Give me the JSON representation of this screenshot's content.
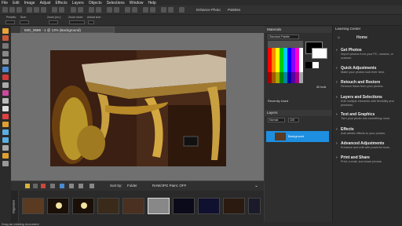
{
  "menu": [
    "File",
    "Edit",
    "Image",
    "Adjust",
    "Effects",
    "Layers",
    "Objects",
    "Selections",
    "Window",
    "Help"
  ],
  "toolbar": {
    "enhance_photo": "Enhance Photo",
    "palettes": "Palettes"
  },
  "options": {
    "labels": [
      "Presets:",
      "Size:",
      "Zoom (no.):",
      "Zoom more:",
      "Actual size:"
    ]
  },
  "document": {
    "tab": "IMG_9686 - 1 @ 13% (Background)"
  },
  "organizer": {
    "label": "Organizer",
    "sort_by": "Sort by:",
    "sort_value": "Folder",
    "filter": "RAW/JPG Pairs: OFF"
  },
  "materials": {
    "title": "Materials",
    "palette_select": "Standard Palette",
    "all_tools": "All tools",
    "recently_used": "Recently Used"
  },
  "layers": {
    "title": "Layers",
    "blend": "Normal",
    "opacity": "100",
    "layer_name": "Background"
  },
  "learning": {
    "title": "Learning Center",
    "home": "Home",
    "items": [
      {
        "title": "Get Photos",
        "desc": "Import photos from your PC, camera, or scanner."
      },
      {
        "title": "Quick Adjustments",
        "desc": "Make your photos look their best."
      },
      {
        "title": "Retouch and Restore",
        "desc": "Remove flaws from your photos."
      },
      {
        "title": "Layers and Selections",
        "desc": "Edit multiple elements with flexibility and precision."
      },
      {
        "title": "Text and Graphics",
        "desc": "Turn your photo into something more."
      },
      {
        "title": "Effects",
        "desc": "Add artistic effects to your photos."
      },
      {
        "title": "Advanced Adjustments",
        "desc": "Enhance and edit with powerful tools."
      },
      {
        "title": "Print and Share",
        "desc": "Print, e-mail, and share photos."
      }
    ]
  },
  "status": {
    "text": "Drag an existing document"
  },
  "colors": {
    "accent": "#1e8fe0"
  }
}
